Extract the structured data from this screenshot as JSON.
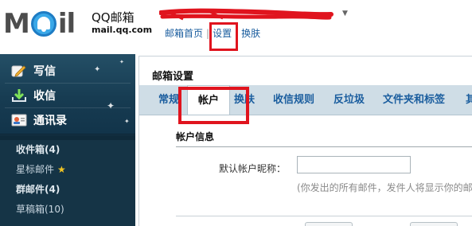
{
  "header": {
    "logo_left": "M",
    "logo_right": "il",
    "brand": "QQ邮箱",
    "domain": "mail.qq.com",
    "user_caret": "▼",
    "links": [
      {
        "label": "邮箱首页"
      },
      {
        "label": "设置"
      },
      {
        "label": "换肤"
      }
    ],
    "link_separator": "|"
  },
  "sidebar": {
    "actions": [
      {
        "label": "写信",
        "icon": "pen-icon"
      },
      {
        "label": "收信",
        "icon": "inbox-download-icon"
      },
      {
        "label": "通讯录",
        "icon": "contacts-card-icon"
      }
    ],
    "folders": [
      {
        "label": "收件箱(4)"
      },
      {
        "label": "星标邮件",
        "star": "★"
      },
      {
        "label": "群邮件(4)"
      },
      {
        "label": "草稿箱(10)"
      }
    ]
  },
  "main": {
    "title": "邮箱设置",
    "tabs": [
      {
        "label": "常规"
      },
      {
        "label": "帐户",
        "active": true
      },
      {
        "label": "换肤"
      },
      {
        "label": "收信规则"
      },
      {
        "label": "反垃圾"
      },
      {
        "label": "文件夹和标签"
      },
      {
        "label": "其"
      }
    ],
    "section_title": "帐户信息",
    "nickname_label": "默认帐户昵称：",
    "nickname_value": "",
    "nickname_note": "(你发出的所有邮件，发件人将显示你的邮"
  },
  "colors": {
    "highlight": "#e0141e",
    "link": "#1a5d9e",
    "sidebar_bg": "#153446",
    "tab_bar_bg": "#cfdde6"
  }
}
